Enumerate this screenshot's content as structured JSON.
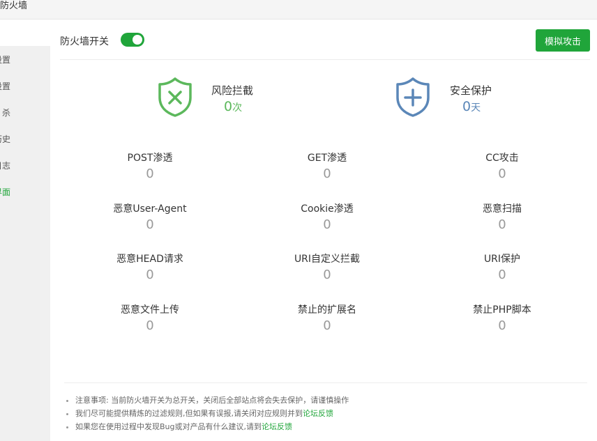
{
  "window": {
    "title": "防火墙"
  },
  "sidebar": {
    "items": [
      {
        "label": "设置"
      },
      {
        "label": "设置"
      },
      {
        "label": "杀"
      },
      {
        "label": "历史"
      },
      {
        "label": "日志"
      },
      {
        "label": "界面",
        "active": true
      }
    ]
  },
  "header": {
    "switch_label": "防火墙开关",
    "switch_on": true,
    "simulate_button": "模拟攻击"
  },
  "summary": {
    "risk": {
      "title": "风险拦截",
      "count": "0",
      "unit": "次",
      "color": "#5cb85c",
      "icon": "shield-x-icon"
    },
    "safe": {
      "title": "安全保护",
      "count": "0",
      "unit": "天",
      "color": "#5b87b8",
      "icon": "shield-plus-icon"
    }
  },
  "stats": [
    {
      "label": "POST渗透",
      "value": "0"
    },
    {
      "label": "GET渗透",
      "value": "0"
    },
    {
      "label": "CC攻击",
      "value": "0"
    },
    {
      "label": "恶意User-Agent",
      "value": "0"
    },
    {
      "label": "Cookie渗透",
      "value": "0"
    },
    {
      "label": "恶意扫描",
      "value": "0"
    },
    {
      "label": "恶意HEAD请求",
      "value": "0"
    },
    {
      "label": "URI自定义拦截",
      "value": "0"
    },
    {
      "label": "URI保护",
      "value": "0"
    },
    {
      "label": "恶意文件上传",
      "value": "0"
    },
    {
      "label": "禁止的扩展名",
      "value": "0"
    },
    {
      "label": "禁止PHP脚本",
      "value": "0"
    }
  ],
  "notes": [
    {
      "text": "注意事项: 当前防火墙开关为总开关，关闭后全部站点将会失去保护，请谨慎操作",
      "link": ""
    },
    {
      "text": "我们尽可能提供精炼的过滤规则,但如果有误报,请关闭对应规则并到",
      "link": "论坛反馈"
    },
    {
      "text": "如果您在使用过程中发现Bug或对产品有什么建议,请到",
      "link": "论坛反馈"
    }
  ],
  "colors": {
    "accent": "#20a53a",
    "risk": "#5cb85c",
    "safe": "#5b87b8"
  }
}
